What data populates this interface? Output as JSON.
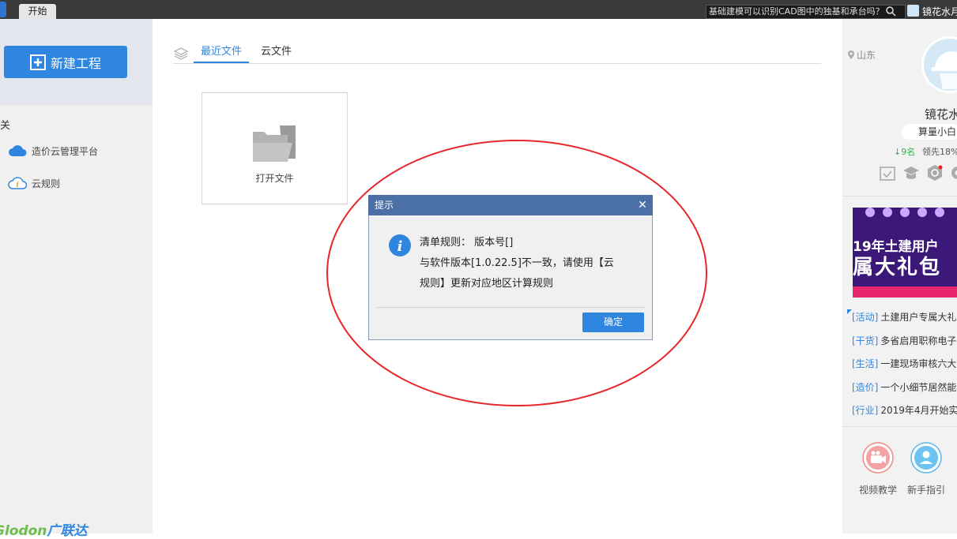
{
  "titlebar": {
    "tab_start": "开始",
    "search_text": "基础建模可以识别CAD图中的独基和承台吗？",
    "user_name": "镜花水月"
  },
  "left": {
    "new_project_label": "新建工程",
    "section_label": "相关",
    "links": [
      {
        "label": "造价云管理平台",
        "icon": "cloud-icon"
      },
      {
        "label": "云规则",
        "icon": "cloud-info-icon"
      }
    ],
    "brand_latin": "Glodon",
    "brand_cn": "广联达"
  },
  "center": {
    "tabs": [
      {
        "label": "最近文件",
        "active": true
      },
      {
        "label": "云文件",
        "active": false
      }
    ],
    "open_file_label": "打开文件"
  },
  "dialog": {
    "title": "提示",
    "line1": "清单规则： 版本号[]",
    "line2": "与软件版本[1.0.22.5]不一致，请使用【云",
    "line3": "规则】更新对应地区计算规则",
    "ok_label": "确定"
  },
  "right": {
    "location": "山东",
    "profile_name": "镜花水",
    "level": "算量小白",
    "rank_change": "↓9名",
    "rank_lead": "领先18%",
    "banner_line1": "19年土建用户",
    "banner_line2": "属大礼包",
    "news": [
      {
        "tag": "[活动]",
        "title": "土建用户专属大礼"
      },
      {
        "tag": "[干货]",
        "title": "多省启用职称电子"
      },
      {
        "tag": "[生活]",
        "title": "一建现场审核六大"
      },
      {
        "tag": "[造价]",
        "title": "一个小细节居然能"
      },
      {
        "tag": "[行业]",
        "title": "2019年4月开始实"
      }
    ],
    "quick": [
      {
        "label": "视频教学",
        "icon": "video-camera-icon"
      },
      {
        "label": "新手指引",
        "icon": "user-guide-icon"
      }
    ]
  },
  "colors": {
    "accent": "#2f86e0",
    "dialog_title": "#4a70a6",
    "annotation": "#e8262a",
    "rank_down": "#2bb24c"
  }
}
